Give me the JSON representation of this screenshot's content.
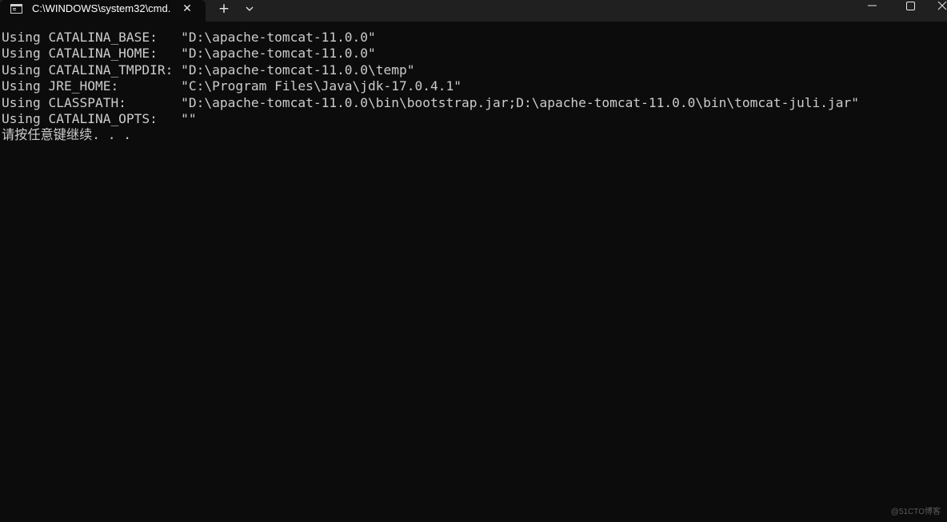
{
  "window": {
    "tab_title": "C:\\WINDOWS\\system32\\cmd.",
    "icons": {
      "tab": "cmd-console-icon",
      "tab_close": "close-icon",
      "new_tab": "plus-icon",
      "dropdown": "chevron-down-icon",
      "minimize": "minimize-icon",
      "maximize": "maximize-icon",
      "close": "close-icon"
    }
  },
  "console": {
    "lines": [
      "Using CATALINA_BASE:   \"D:\\apache-tomcat-11.0.0\"",
      "Using CATALINA_HOME:   \"D:\\apache-tomcat-11.0.0\"",
      "Using CATALINA_TMPDIR: \"D:\\apache-tomcat-11.0.0\\temp\"",
      "Using JRE_HOME:        \"C:\\Program Files\\Java\\jdk-17.0.4.1\"",
      "Using CLASSPATH:       \"D:\\apache-tomcat-11.0.0\\bin\\bootstrap.jar;D:\\apache-tomcat-11.0.0\\bin\\tomcat-juli.jar\"",
      "Using CATALINA_OPTS:   \"\"",
      "请按任意键继续. . ."
    ],
    "text_color": "#cccccc",
    "background": "#0c0c0c"
  },
  "watermark": "@51CTO博客"
}
